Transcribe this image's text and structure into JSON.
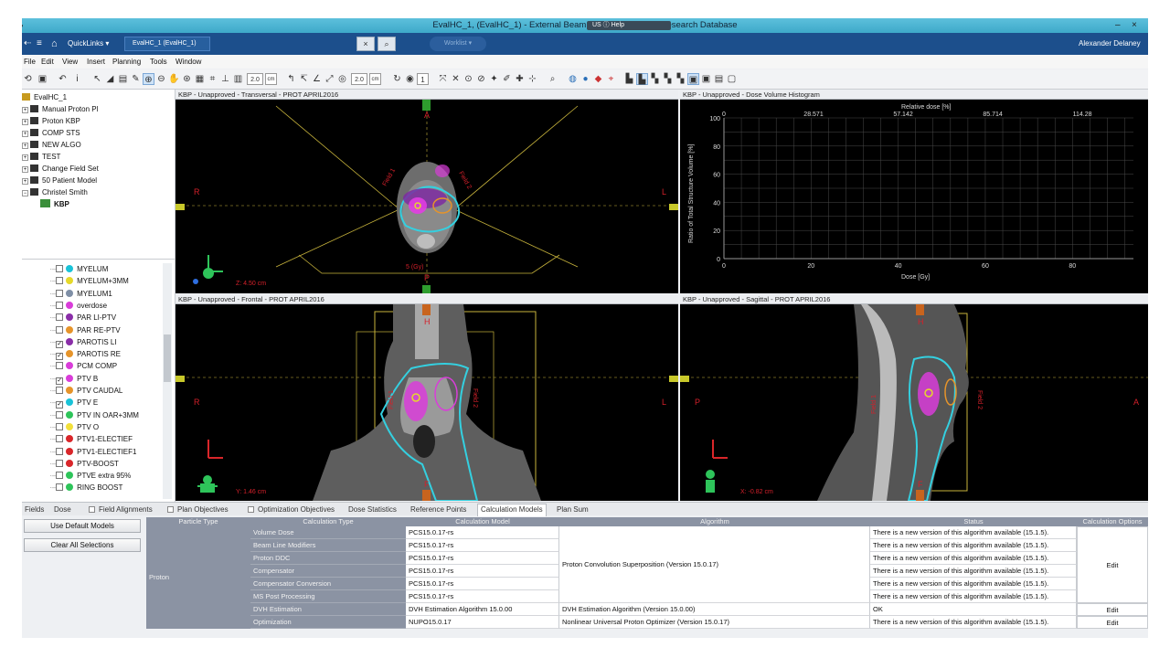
{
  "window": {
    "title": "EvalHC_1, (EvalHC_1) - External Beam Planning - Clinical Research Database",
    "minimize": "–",
    "close": "×",
    "overlay_us": "US",
    "overlay_help": "Help"
  },
  "nav": {
    "quicklinks": "QuickLinks ▾",
    "active_tab": "EvalHC_1 (EvalHC_1)",
    "worklist": "Worklist ▾",
    "user": "Alexander Delaney"
  },
  "menu": [
    "File",
    "Edit",
    "View",
    "Insert",
    "Planning",
    "Tools",
    "Window"
  ],
  "toolbar": {
    "slice_value_1": "2.0",
    "unit_1": "cm",
    "slice_value_2": "2.0",
    "unit_2": "cm",
    "count": "1"
  },
  "tree": [
    {
      "label": "EvalHC_1",
      "level": 0
    },
    {
      "label": "Manual Proton Pl",
      "level": 1
    },
    {
      "label": "Proton KBP",
      "level": 1
    },
    {
      "label": "COMP STS",
      "level": 1
    },
    {
      "label": "NEW ALGO",
      "level": 1
    },
    {
      "label": "TEST",
      "level": 1
    },
    {
      "label": "Change Field Set",
      "level": 1
    },
    {
      "label": "50 Patient Model",
      "level": 1
    },
    {
      "label": "Christel Smith",
      "level": 1
    },
    {
      "label": "KBP",
      "level": 2
    }
  ],
  "structures": [
    {
      "name": "MYELUM",
      "color": "#19c3d8",
      "checked": false
    },
    {
      "name": "MYELUM+3MM",
      "color": "#e6d92a",
      "checked": false
    },
    {
      "name": "MYELUM1",
      "color": "#7f8fa6",
      "checked": false
    },
    {
      "name": "overdose",
      "color": "#d93dd9",
      "checked": false
    },
    {
      "name": "PAR LI-PTV",
      "color": "#8a2ea8",
      "checked": false
    },
    {
      "name": "PAR RE-PTV",
      "color": "#e6942a",
      "checked": false
    },
    {
      "name": "PAROTIS LI",
      "color": "#8a2ea8",
      "checked": true
    },
    {
      "name": "PAROTIS RE",
      "color": "#e6942a",
      "checked": true
    },
    {
      "name": "PCM COMP",
      "color": "#d93dd9",
      "checked": false
    },
    {
      "name": "PTV B",
      "color": "#d93dd9",
      "checked": true
    },
    {
      "name": "PTV CAUDAL",
      "color": "#e6942a",
      "checked": false
    },
    {
      "name": "PTV E",
      "color": "#19c3d8",
      "checked": true
    },
    {
      "name": "PTV IN OAR+3MM",
      "color": "#2ec45a",
      "checked": false
    },
    {
      "name": "PTV O",
      "color": "#f2e03a",
      "checked": false
    },
    {
      "name": "PTV1-ELECTIEF",
      "color": "#d9262a",
      "checked": false
    },
    {
      "name": "PTV1-ELECTIEF1",
      "color": "#d9262a",
      "checked": false
    },
    {
      "name": "PTV-BOOST",
      "color": "#d9262a",
      "checked": false
    },
    {
      "name": "PTVE extra 95%",
      "color": "#2ec45a",
      "checked": false
    },
    {
      "name": "RING BOOST",
      "color": "#2ec45a",
      "checked": false
    }
  ],
  "viewports": {
    "transversal": {
      "title": "KBP - Unapproved - Transversal - PROT APRIL2016",
      "coord": "Z: 4.50 cm",
      "left": "R",
      "right": "L",
      "top": "A",
      "bottom": "P",
      "field1": "Field 1",
      "field2": "Field 2",
      "dose": "5 (Gy)"
    },
    "frontal": {
      "title": "KBP - Unapproved - Frontal - PROT APRIL2016",
      "coord": "Y: 1.46 cm",
      "left": "R",
      "right": "L",
      "top": "H",
      "bottom": "F",
      "field1": "Field 1",
      "field2": "Field 2"
    },
    "sagittal": {
      "title": "KBP - Unapproved - Sagittal - PROT APRIL2016",
      "coord": "X: -0.82 cm",
      "left": "P",
      "right": "A",
      "top": "H",
      "bottom": "F",
      "field1": "Field 1",
      "field2": "Field 2"
    },
    "dvh": {
      "title": "KBP - Unapproved - Dose Volume Histogram"
    }
  },
  "chart_data": {
    "type": "line",
    "title": "",
    "xlabel": "Dose [Gy]",
    "ylabel": "Ratio of Total Structure Volume [%]",
    "x2label": "Relative dose [%]",
    "xlim": [
      0,
      94
    ],
    "ylim": [
      0,
      100
    ],
    "xticks": [
      0,
      20,
      40,
      60,
      80
    ],
    "yticks": [
      0,
      20,
      40,
      60,
      80,
      100
    ],
    "x2ticks": [
      "0",
      "28.571",
      "57.142",
      "85.714",
      "114.28"
    ],
    "grid": true,
    "series": []
  },
  "tabs": [
    {
      "label": "Fields",
      "checkbox": false
    },
    {
      "label": "Dose",
      "checkbox": false
    },
    {
      "label": "Field Alignments",
      "checkbox": true
    },
    {
      "label": "Plan Objectives",
      "checkbox": true
    },
    {
      "label": "Optimization Objectives",
      "checkbox": true
    },
    {
      "label": "Dose Statistics",
      "checkbox": false
    },
    {
      "label": "Reference Points",
      "checkbox": false
    },
    {
      "label": "Calculation Models",
      "checkbox": false,
      "active": true
    },
    {
      "label": "Plan Sum",
      "checkbox": false
    }
  ],
  "buttons": {
    "use_default": "Use Default Models",
    "clear_all": "Clear All Selections"
  },
  "table": {
    "headers": [
      "Particle Type",
      "Calculation Type",
      "Calculation Model",
      "Algorithm",
      "Status",
      "Calculation Options"
    ],
    "particle": "Proton",
    "rows": [
      {
        "type": "Volume Dose",
        "model": "PCS15.0.17-rs",
        "status": "There is a new version of this algorithm available (15.1.5)."
      },
      {
        "type": "Beam Line Modifiers",
        "model": "PCS15.0.17-rs",
        "status": "There is a new version of this algorithm available (15.1.5)."
      },
      {
        "type": "Proton DDC",
        "model": "PCS15.0.17-rs",
        "status": "There is a new version of this algorithm available (15.1.5)."
      },
      {
        "type": "Compensator",
        "model": "PCS15.0.17-rs",
        "status": "There is a new version of this algorithm available (15.1.5)."
      },
      {
        "type": "Compensator Conversion",
        "model": "PCS15.0.17-rs",
        "status": "There is a new version of this algorithm available (15.1.5)."
      },
      {
        "type": "MS Post Processing",
        "model": "PCS15.0.17-rs",
        "status": "There is a new version of this algorithm available (15.1.5)."
      },
      {
        "type": "DVH Estimation",
        "model": "DVH Estimation Algorithm 15.0.00",
        "status": "OK"
      },
      {
        "type": "Optimization",
        "model": "NUPO15.0.17",
        "status": "There is a new version of this algorithm available (15.1.5)."
      }
    ],
    "algo_group": "Proton Convolution Superposition (Version 15.0.17)",
    "algo_dvh": "DVH Estimation Algorithm (Version 15.0.00)",
    "algo_opt": "Nonlinear Universal Proton Optimizer (Version 15.0.17)",
    "edit": "Edit"
  }
}
